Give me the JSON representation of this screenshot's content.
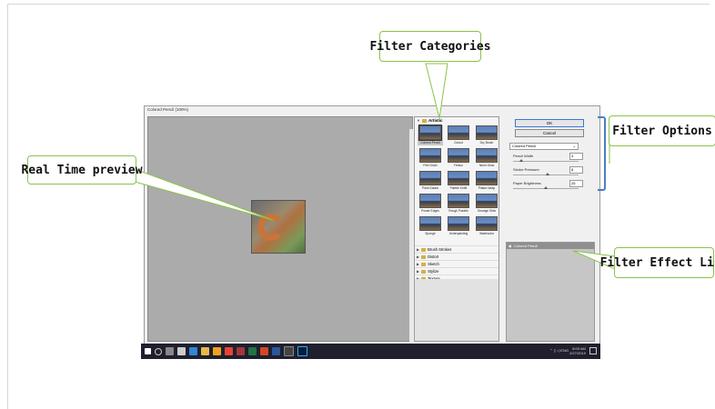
{
  "window": {
    "title": "Colored Pencil (100%)"
  },
  "preview": {
    "zoom": "100%",
    "zoom_minus": "-",
    "zoom_plus": "+"
  },
  "categories": {
    "expanded": "Artistic",
    "thumbnails": [
      "Colored Pencil",
      "Cutout",
      "Dry Brush",
      "Film Grain",
      "Fresco",
      "Neon Glow",
      "Paint Daubs",
      "Palette Knife",
      "Plastic Wrap",
      "Poster Edges",
      "Rough Pastels",
      "Smudge Stick",
      "Sponge",
      "Underpainting",
      "Watercolor"
    ],
    "folders": [
      "Brush Strokes",
      "Distort",
      "Sketch",
      "Stylize",
      "Texture"
    ]
  },
  "options": {
    "ok": "OK",
    "cancel": "Cancel",
    "filter": "Colored Pencil",
    "params": [
      {
        "label": "Pencil Width",
        "value": "4",
        "level": 0.12
      },
      {
        "label": "Stroke Pressure",
        "value": "8",
        "level": 0.53
      },
      {
        "label": "Paper Brightness",
        "value": "25",
        "level": 0.5
      }
    ]
  },
  "effects": {
    "items": [
      "Colored Pencil"
    ]
  },
  "taskbar": {
    "lang": "ENG",
    "time": "8:09 AM",
    "date": "2/27/2019"
  },
  "annotations": {
    "filter_categories": "Filter Categories",
    "real_time_preview": "Real Time preview",
    "filter_options": "Filter Options",
    "filter_effect_list": "Filter Effect List"
  }
}
